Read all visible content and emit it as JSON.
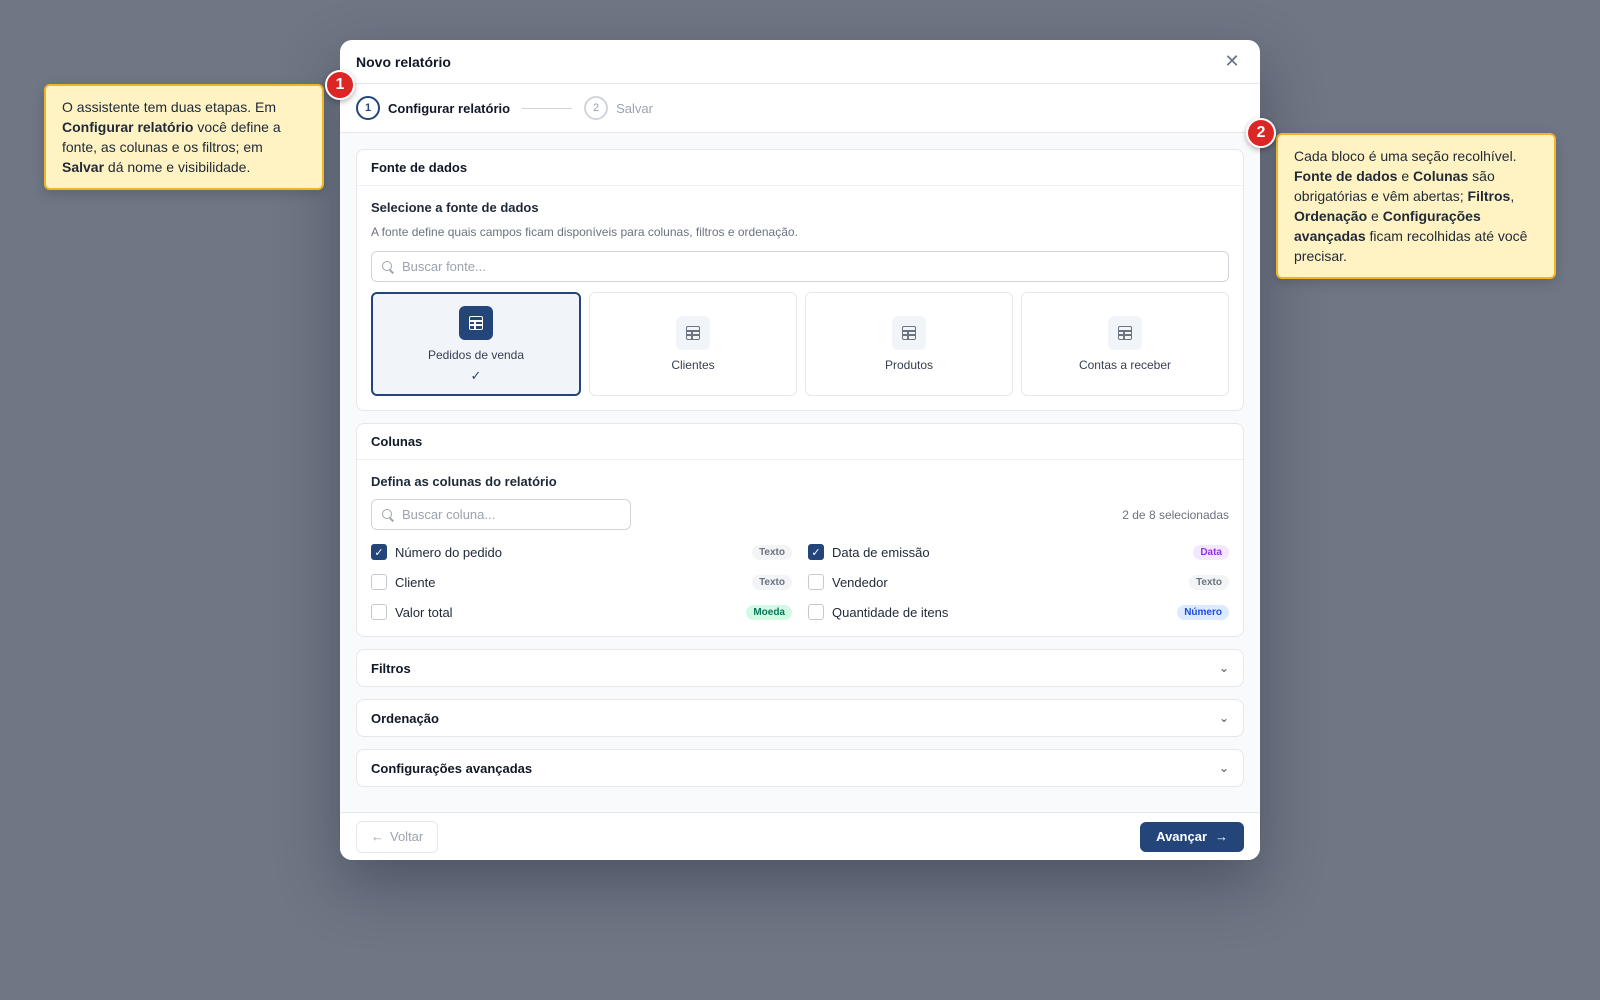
{
  "dialog": {
    "title": "Novo relatório",
    "close_icon": "close-icon"
  },
  "stepper": {
    "steps": [
      {
        "num": "1",
        "label": "Configurar relatório",
        "state": "active"
      },
      {
        "num": "2",
        "label": "Salvar",
        "state": "inactive"
      }
    ]
  },
  "sources_section": {
    "title": "Fonte de dados",
    "subtitle": "Selecione a fonte de dados",
    "help": "A fonte define quais campos ficam disponíveis para colunas, filtros e ordenação.",
    "search_placeholder": "Buscar fonte...",
    "items": [
      {
        "label": "Pedidos de venda",
        "selected": true
      },
      {
        "label": "Clientes",
        "selected": false
      },
      {
        "label": "Produtos",
        "selected": false
      },
      {
        "label": "Contas a receber",
        "selected": false
      }
    ]
  },
  "columns_section": {
    "title": "Colunas",
    "subtitle": "Defina as colunas do relatório",
    "search_placeholder": "Buscar coluna...",
    "count": "2 de 8 selecionadas",
    "items": [
      {
        "label": "Número do pedido",
        "checked": true,
        "type": "Texto"
      },
      {
        "label": "Data de emissão",
        "checked": true,
        "type": "Data"
      },
      {
        "label": "Cliente",
        "checked": false,
        "type": "Texto"
      },
      {
        "label": "Vendedor",
        "checked": false,
        "type": "Texto"
      },
      {
        "label": "Valor total",
        "checked": false,
        "type": "Moeda"
      },
      {
        "label": "Quantidade de itens",
        "checked": false,
        "type": "Número"
      }
    ]
  },
  "collapsed_sections": [
    {
      "title": "Filtros"
    },
    {
      "title": "Ordenação"
    },
    {
      "title": "Configurações avançadas"
    }
  ],
  "footer": {
    "back_label": "Voltar",
    "next_label": "Avançar"
  },
  "callouts": {
    "one": {
      "num": "1",
      "p1": "O assistente tem duas etapas. Em ",
      "b1": "Configurar relatório",
      "p2": " você define a fonte, as colunas e os filtros; em ",
      "b2": "Salvar",
      "p3": " dá nome e visibilidade."
    },
    "two": {
      "num": "2",
      "p1": "Cada bloco é uma seção recolhível. ",
      "b1": "Fonte de dados",
      "p2": " e ",
      "b2": "Colunas",
      "p3": " são obrigatórias e vêm abertas; ",
      "b3": "Filtros",
      "p4": ", ",
      "b4": "Ordenação",
      "p5": " e ",
      "b5": "Configurações avançadas",
      "p6": " ficam recolhidas até você precisar."
    }
  },
  "colors": {
    "accent": "#23457a",
    "callout_bg": "#fff3c4",
    "callout_border": "#f0b429",
    "pin": "#dc2626"
  }
}
